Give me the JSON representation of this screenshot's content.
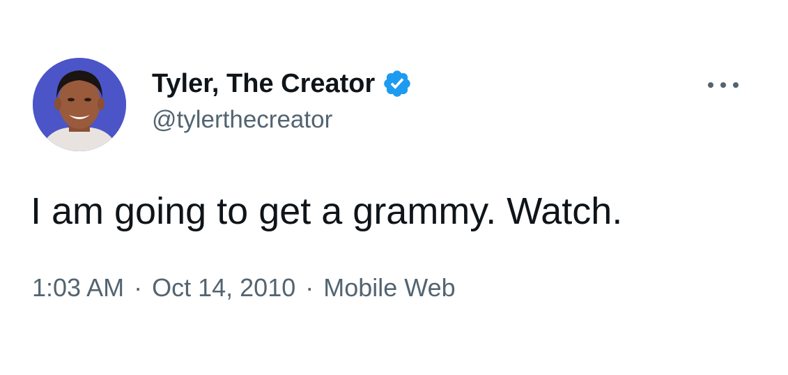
{
  "tweet": {
    "author": {
      "display_name": "Tyler, The Creator",
      "handle": "@tylerthecreator",
      "verified": true,
      "verified_color": "#1d9bf0",
      "avatar_background": "#4b55c8"
    },
    "text": "I am going to get a grammy. Watch.",
    "meta": {
      "time": "1:03 AM",
      "separator": "·",
      "date": "Oct 14, 2010",
      "source": "Mobile Web"
    },
    "more_icon": "more-dots-icon"
  }
}
